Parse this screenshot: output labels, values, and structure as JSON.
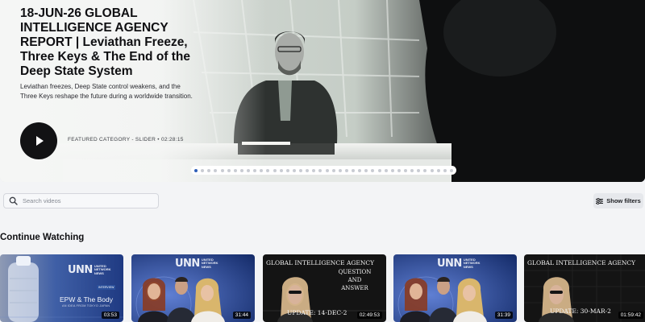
{
  "hero": {
    "title": "18-JUN-26 GLOBAL INTELLIGENCE AGENCY REPORT | Leviathan Freeze, Three Keys & The End of the Deep State System",
    "description": "Leviathan freezes, Deep State control weakens, and the Three Keys reshape the future during a worldwide transition.",
    "meta": "FEATURED CATEGORY - SLIDER • 02:28:15",
    "play_icon": "play-icon",
    "slider_dot_count": 40,
    "active_dot": 0
  },
  "search": {
    "placeholder": "Search videos",
    "icon": "search-icon"
  },
  "filters": {
    "label": "Show filters",
    "icon": "filter-icon"
  },
  "continue_watching": {
    "title": "Continue Watching",
    "cards": [
      {
        "duration": "03:53",
        "logo": "UNN",
        "logo_words": "UNITED NETWORK NEWS",
        "tag": "INTERVIEW",
        "title": "EPW & The Body",
        "subtitle": "AN IDEA FROM TOKYO JAPAN"
      },
      {
        "duration": "31:44",
        "logo": "UNN",
        "logo_words": "UNITED NETWORK NEWS"
      },
      {
        "duration": "02:49:53",
        "heading": "GLOBAL INTELLIGENCE AGENCY",
        "subtitle_1": "QUESTION",
        "subtitle_2": "AND",
        "subtitle_3": "ANSWER",
        "update": "UPDATE: 14-DEC-2"
      },
      {
        "duration": "31:39",
        "logo": "UNN",
        "logo_words": "UNITED NETWORK NEWS"
      },
      {
        "duration": "01:59:42",
        "heading": "GLOBAL INTELLIGENCE AGENCY",
        "update": "UPDATE: 30-MAR-2"
      }
    ]
  }
}
